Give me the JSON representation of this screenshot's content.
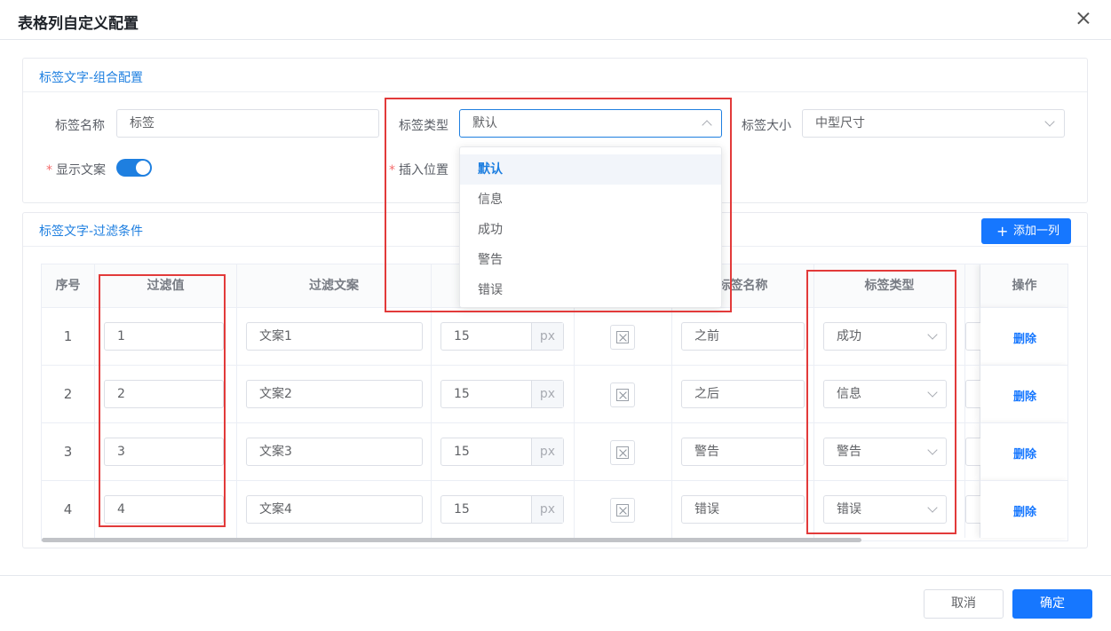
{
  "dialog": {
    "title": "表格列自定义配置"
  },
  "section1": {
    "title": "标签文字-组合配置",
    "tag_name_label": "标签名称",
    "tag_name_value": "标签",
    "tag_type_label": "标签类型",
    "tag_type_value": "默认",
    "tag_size_label": "标签大小",
    "tag_size_value": "中型尺寸",
    "show_text_label": "显示文案",
    "show_text_on": true,
    "insert_pos_label": "插入位置",
    "required_mark": "*"
  },
  "dropdown": {
    "options": [
      "默认",
      "信息",
      "成功",
      "警告",
      "错误"
    ],
    "selected": "默认"
  },
  "section2": {
    "title": "标签文字-过滤条件",
    "add_button": "添加一列",
    "add_icon": "+"
  },
  "table": {
    "headers": {
      "seq": "序号",
      "filter_value": "过滤值",
      "filter_text": "过滤文案",
      "tag_name": "标签名称",
      "tag_type": "标签类型",
      "action": "操作"
    },
    "unit_suffix": "px",
    "delete_label": "删除",
    "rows": [
      {
        "seq": "1",
        "value": "1",
        "text": "文案1",
        "size": "15",
        "name": "之前",
        "type": "成功"
      },
      {
        "seq": "2",
        "value": "2",
        "text": "文案2",
        "size": "15",
        "name": "之后",
        "type": "信息"
      },
      {
        "seq": "3",
        "value": "3",
        "text": "文案3",
        "size": "15",
        "name": "警告",
        "type": "警告"
      },
      {
        "seq": "4",
        "value": "4",
        "text": "文案4",
        "size": "15",
        "name": "错误",
        "type": "错误"
      }
    ]
  },
  "footer": {
    "cancel": "取消",
    "confirm": "确定"
  },
  "colors": {
    "accent": "#1677ff",
    "highlight": "#e23a3a"
  }
}
